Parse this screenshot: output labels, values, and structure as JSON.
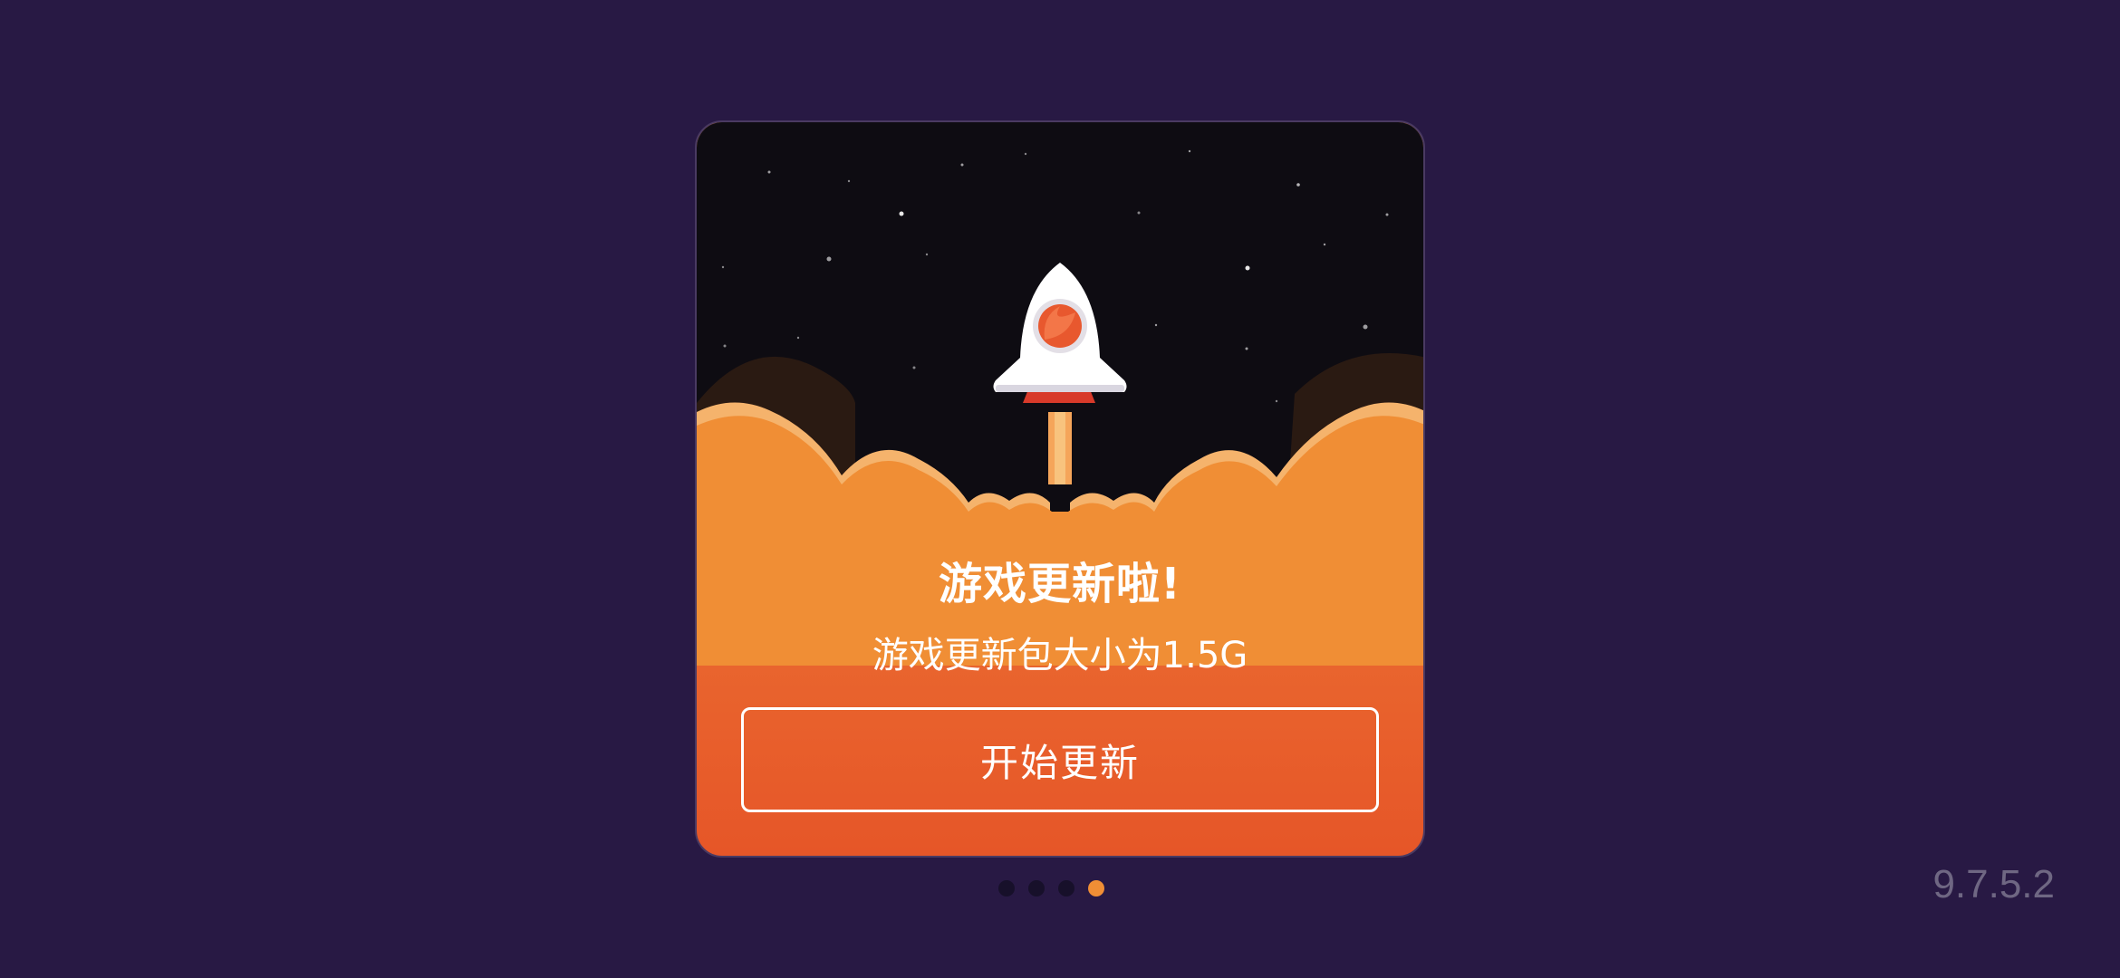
{
  "dialog": {
    "title": "游戏更新啦!",
    "subtitle": "游戏更新包大小为1.5G",
    "button_label": "开始更新"
  },
  "pagination": {
    "total": 4,
    "active_index": 3
  },
  "version": "9.7.5.2",
  "colors": {
    "background": "#281944",
    "sky": "#0e0c12",
    "accent_orange": "#f08e35",
    "deep_orange": "#e65628",
    "rocket_window": "#e8582e"
  },
  "icons": {
    "illustration": "rocket-launch-icon"
  }
}
